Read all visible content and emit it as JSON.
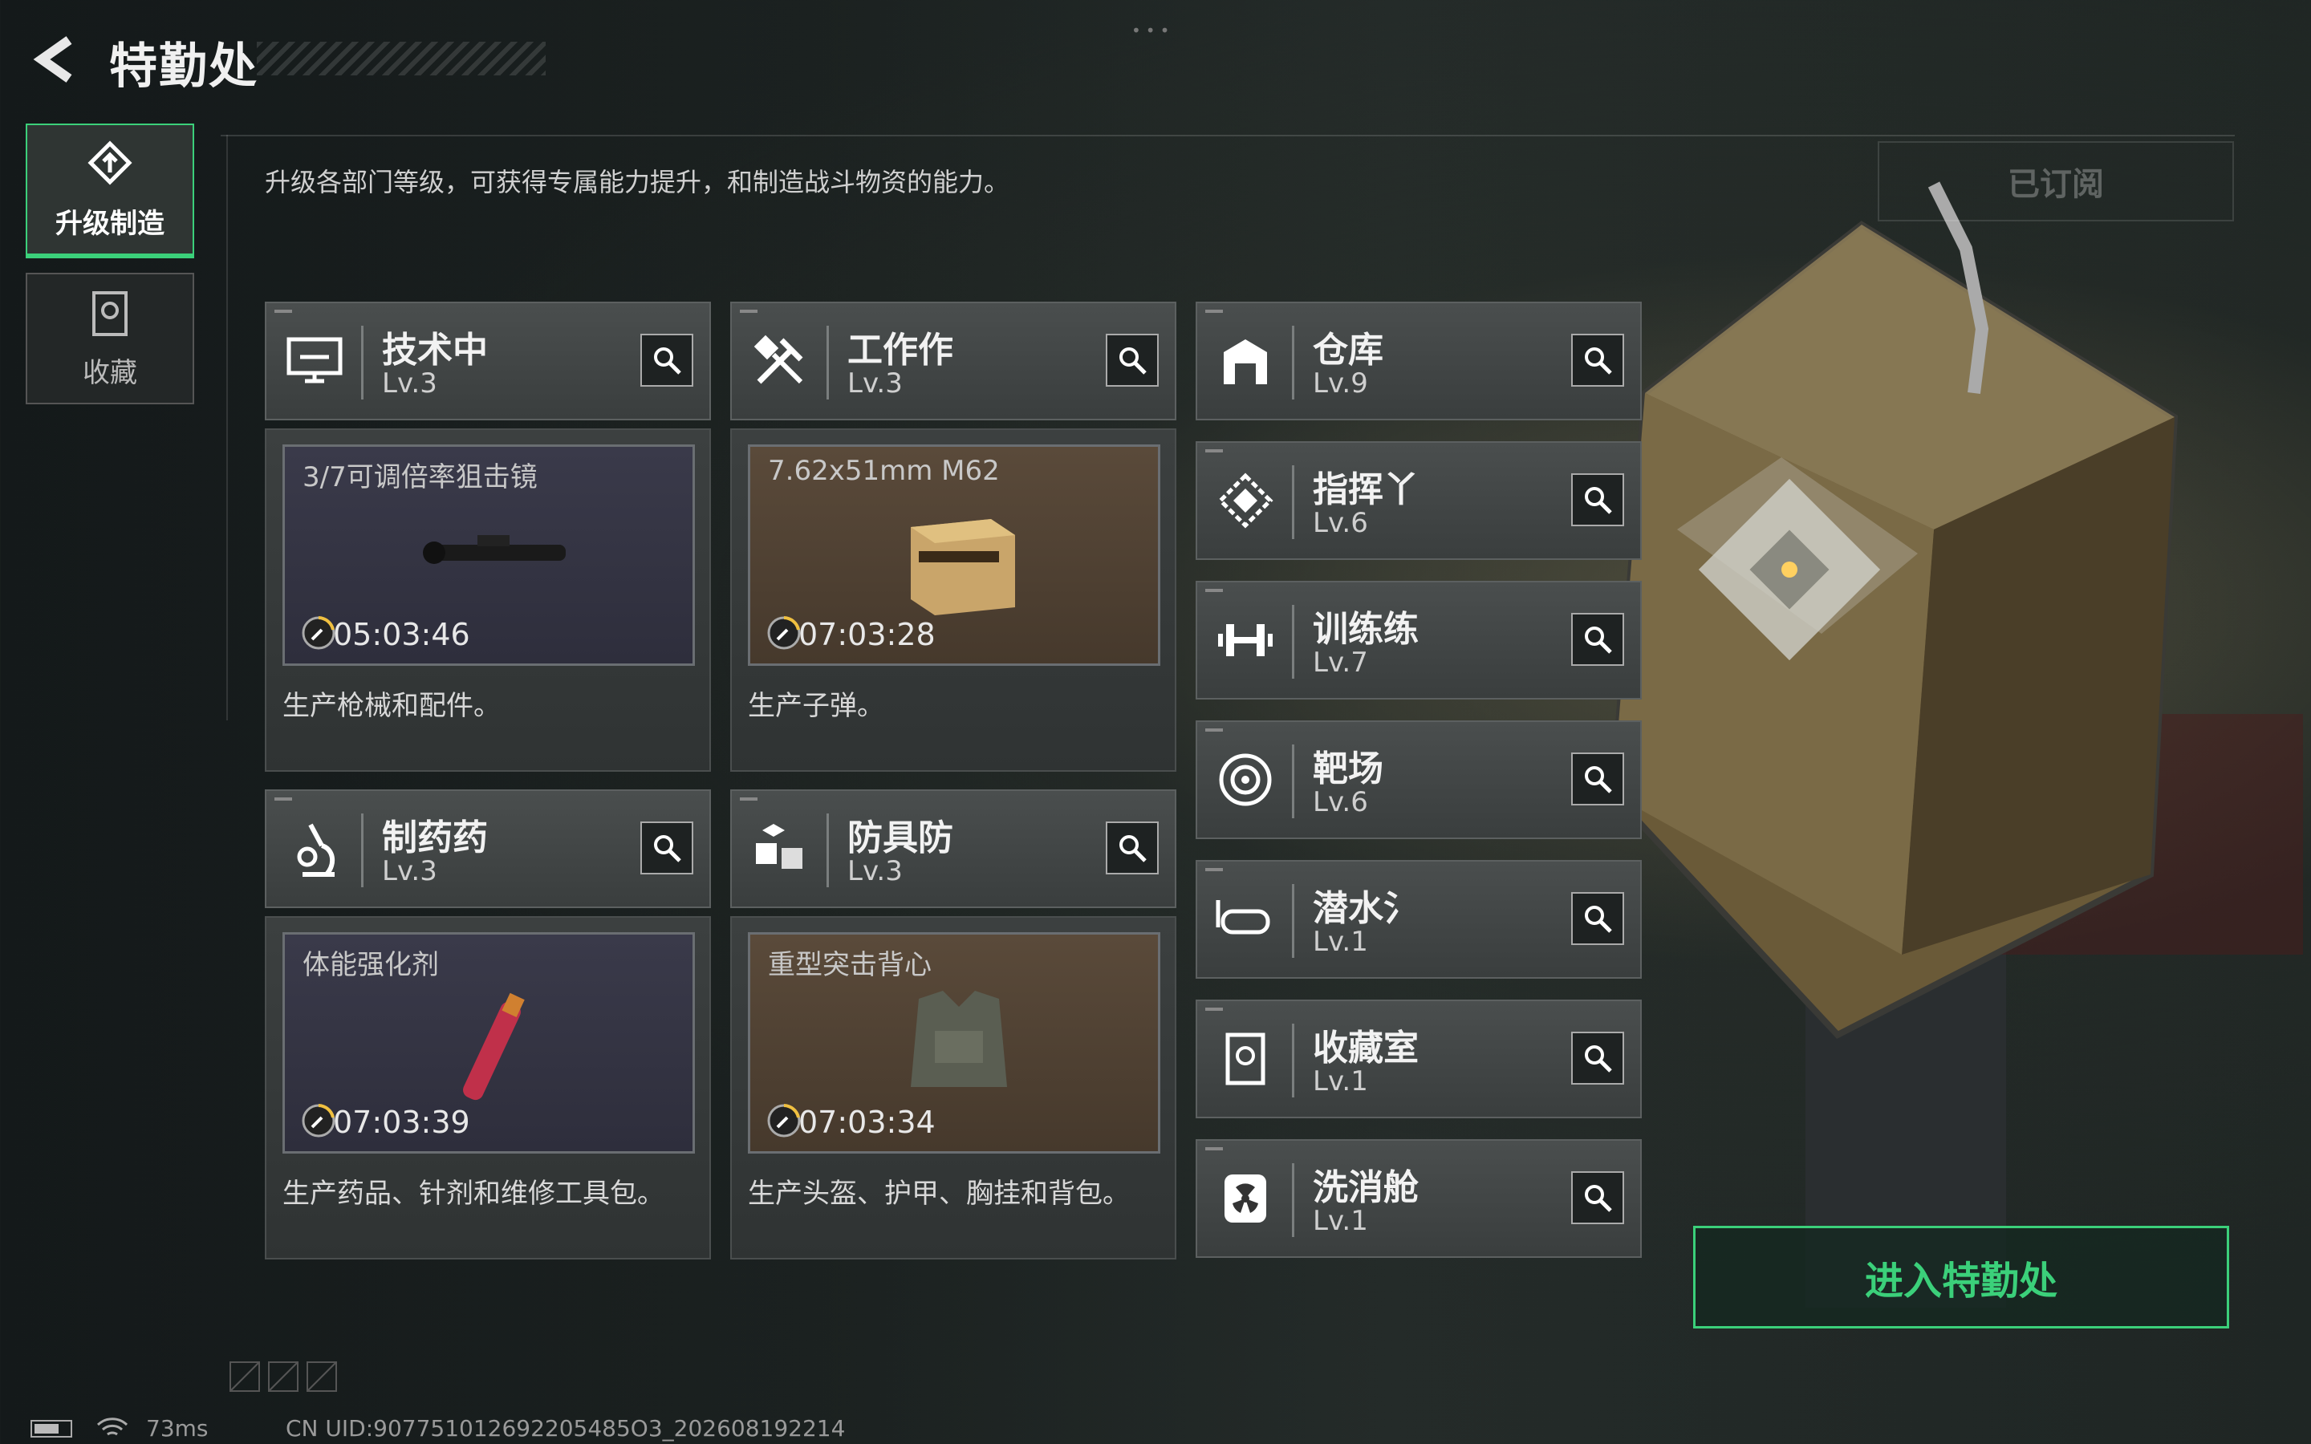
{
  "header": {
    "title": "特勤处"
  },
  "sidebar": {
    "tabs": [
      {
        "label": "升级制造",
        "active": true
      },
      {
        "label": "收藏",
        "active": false
      }
    ]
  },
  "main": {
    "description": "升级各部门等级，可获得专属能力提升，和制造战斗物资的能力。",
    "subscribed_label": "已订阅"
  },
  "production_depts": [
    {
      "name": "技术中",
      "level": "Lv.3",
      "item": "3/7可调倍率狙击镜",
      "timer": "05:03:46",
      "desc": "生产枪械和配件。"
    },
    {
      "name": "工作作",
      "level": "Lv.3",
      "item": "7.62x51mm M62",
      "timer": "07:03:28",
      "desc": "生产子弹。"
    },
    {
      "name": "制药药",
      "level": "Lv.3",
      "item": "体能强化剂",
      "timer": "07:03:39",
      "desc": "生产药品、针剂和维修工具包。"
    },
    {
      "name": "防具防",
      "level": "Lv.3",
      "item": "重型突击背心",
      "timer": "07:03:34",
      "desc": "生产头盔、护甲、胸挂和背包。"
    }
  ],
  "facility_depts": [
    {
      "name": "仓库",
      "level": "Lv.9"
    },
    {
      "name": "指挥丫",
      "level": "Lv.6"
    },
    {
      "name": "训练练",
      "level": "Lv.7"
    },
    {
      "name": "靶场",
      "level": "Lv.6"
    },
    {
      "name": "潜水氵",
      "level": "Lv.1"
    },
    {
      "name": "收藏室",
      "level": "Lv.1"
    },
    {
      "name": "洗消舱",
      "level": "Lv.1"
    }
  ],
  "enter_button": "进入特勤处",
  "footer": {
    "ping": "73ms",
    "uid": "CN UID:907751012692205485O3_202608192214"
  },
  "colors": {
    "accent": "#3bd07a"
  }
}
